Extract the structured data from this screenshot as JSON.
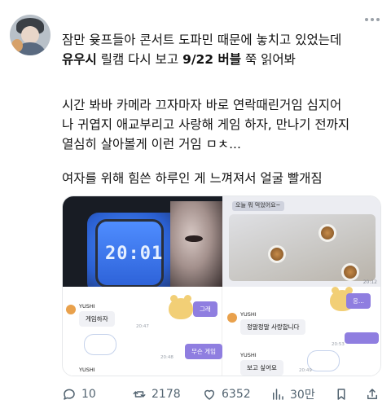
{
  "post": {
    "lines": [
      "잠만 윶프들아 콘서트 도파민 때문에 놓치고 있었는데",
      "릴캠 다시 보고",
      "쭉 읽어봐",
      "시간 봐바 카메라 끄자마자 바로 연락때린거임 심지어",
      "나 귀엽지 애교부리고 사랑해 게임 하자, 만나기 전까지",
      "열심히 살아볼게 이런 거임 ㅁㅊ...",
      "여자를 위해 힘쓴 하루인 게 느껴져서 얼굴 빨개짐"
    ],
    "bold_1": "유우시",
    "bold_2": "9/22 버블"
  },
  "media": {
    "phone_time": "20:01",
    "shot_caption": "오늘 뭐 먹었어요~",
    "shot_ts": "20:12",
    "chat": {
      "sender_1": "YUSHI",
      "sender_2": "YUSHI",
      "sender_3": "YUSHI",
      "sender_4": "YUSHI",
      "msg_game": "게임하자",
      "msg_what": "무슨 게임",
      "msg_love": "정말정말 사랑합니다",
      "msg_see": "보고 싶어요",
      "msg_geurae": "그래",
      "msg_eung": "응...",
      "ts_a": "20:47",
      "ts_b": "20:48",
      "ts_c": "20:53",
      "ts_d": "20:49"
    }
  },
  "actions": {
    "replies": "10",
    "retweets": "2178",
    "likes": "6352",
    "views": "30만"
  }
}
